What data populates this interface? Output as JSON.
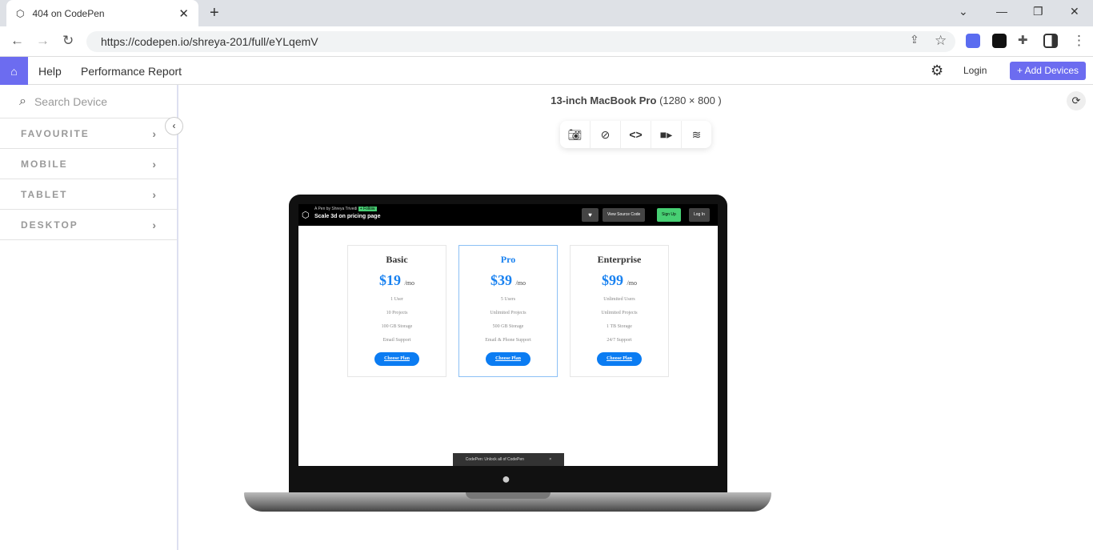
{
  "browser": {
    "tab_title": "404 on CodePen",
    "url": "https://codepen.io/shreya-201/full/eYLqemV"
  },
  "header": {
    "nav": [
      "Help",
      "Performance Report"
    ],
    "login": "Login",
    "add_devices": "+ Add Devices"
  },
  "sidebar": {
    "search_placeholder": "Search Device",
    "items": [
      "FAVOURITE",
      "MOBILE",
      "TABLET",
      "DESKTOP"
    ]
  },
  "device": {
    "name": "13-inch MacBook Pro",
    "resolution": "(1280 × 800 )"
  },
  "preview": {
    "byline": "A Pen by Shreya Trivedi",
    "follow": "+ Follow",
    "pen_title": "Scale 3d on pricing page",
    "buttons": [
      "View Source Code",
      "Sign Up",
      "Log In"
    ],
    "plans": [
      {
        "name": "Basic",
        "price": "$19",
        "per": "/mo",
        "features": [
          "1 User",
          "10 Projects",
          "100 GB Storage",
          "Email Support"
        ],
        "cta": "Choose Plan"
      },
      {
        "name": "Pro",
        "price": "$39",
        "per": "/mo",
        "features": [
          "5 Users",
          "Unlimited Projects",
          "500 GB Storage",
          "Email & Phone Support"
        ],
        "cta": "Choose Plan"
      },
      {
        "name": "Enterprise",
        "price": "$99",
        "per": "/mo",
        "features": [
          "Unlimited Users",
          "Unlimited Projects",
          "1 TB Storage",
          "24/7 Support"
        ],
        "cta": "Choose Plan"
      }
    ],
    "promo": "CodePen: Unlock all of CodePen"
  },
  "colors": {
    "accent": "#6c6cf0",
    "price": "#1a82f0",
    "signup": "#47cf73"
  }
}
